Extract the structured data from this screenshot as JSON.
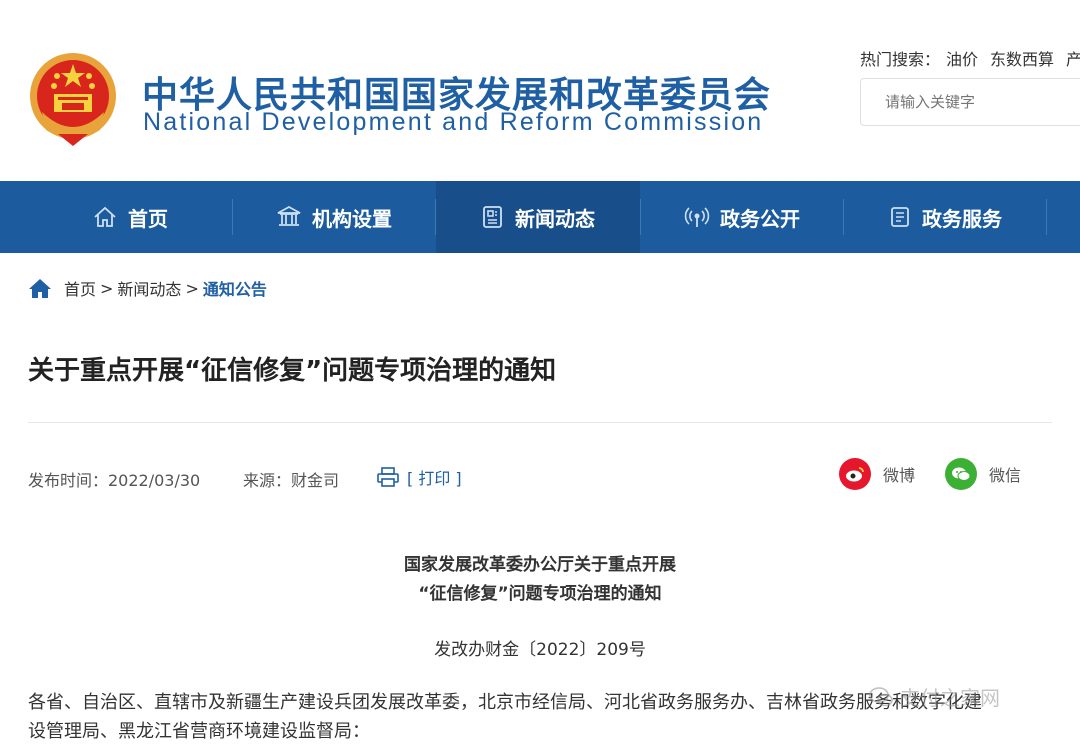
{
  "header": {
    "title_cn": "中华人民共和国国家发展和改革委员会",
    "title_en": "National Development and Reform Commission",
    "hot_label": "热门搜索：",
    "hot_items": [
      "油价",
      "东数西算",
      "产"
    ],
    "search_placeholder": "请输入关键字"
  },
  "nav": {
    "items": [
      {
        "label": "首页",
        "icon": "home-icon"
      },
      {
        "label": "机构设置",
        "icon": "building-icon"
      },
      {
        "label": "新闻动态",
        "icon": "news-icon",
        "active": true
      },
      {
        "label": "政务公开",
        "icon": "signal-icon"
      },
      {
        "label": "政务服务",
        "icon": "document-icon"
      }
    ]
  },
  "breadcrumb": {
    "items": [
      "首页",
      "新闻动态",
      "通知公告"
    ],
    "separator": ">"
  },
  "article": {
    "title": "关于重点开展“征信修复”问题专项治理的通知",
    "publish_time": "发布时间：2022/03/30",
    "source": "来源：财金司",
    "print_label": "[ 打印 ]",
    "share": [
      {
        "label": "微博",
        "icon": "weibo-icon",
        "color": "#e6162d"
      },
      {
        "label": "微信",
        "icon": "wechat-icon",
        "color": "#3cb034"
      }
    ],
    "doc_heading_line1": "国家发展改革委办公厅关于重点开展",
    "doc_heading_line2": "“征信修复”问题专项治理的通知",
    "doc_number": "发改办财金〔2022〕209号",
    "body_line1": "各省、自治区、直辖市及新疆生产建设兵团发展改革委，北京市经信局、河北省政务服务办、吉林省政务服务和数字化建",
    "body_line2": "设管理局、黑龙江省营商环境建设监督局："
  },
  "watermark": "支付之家网",
  "colors": {
    "brand_blue": "#1f5fa3",
    "nav_bg": "#1b5b9e",
    "nav_active": "#184f8a"
  }
}
